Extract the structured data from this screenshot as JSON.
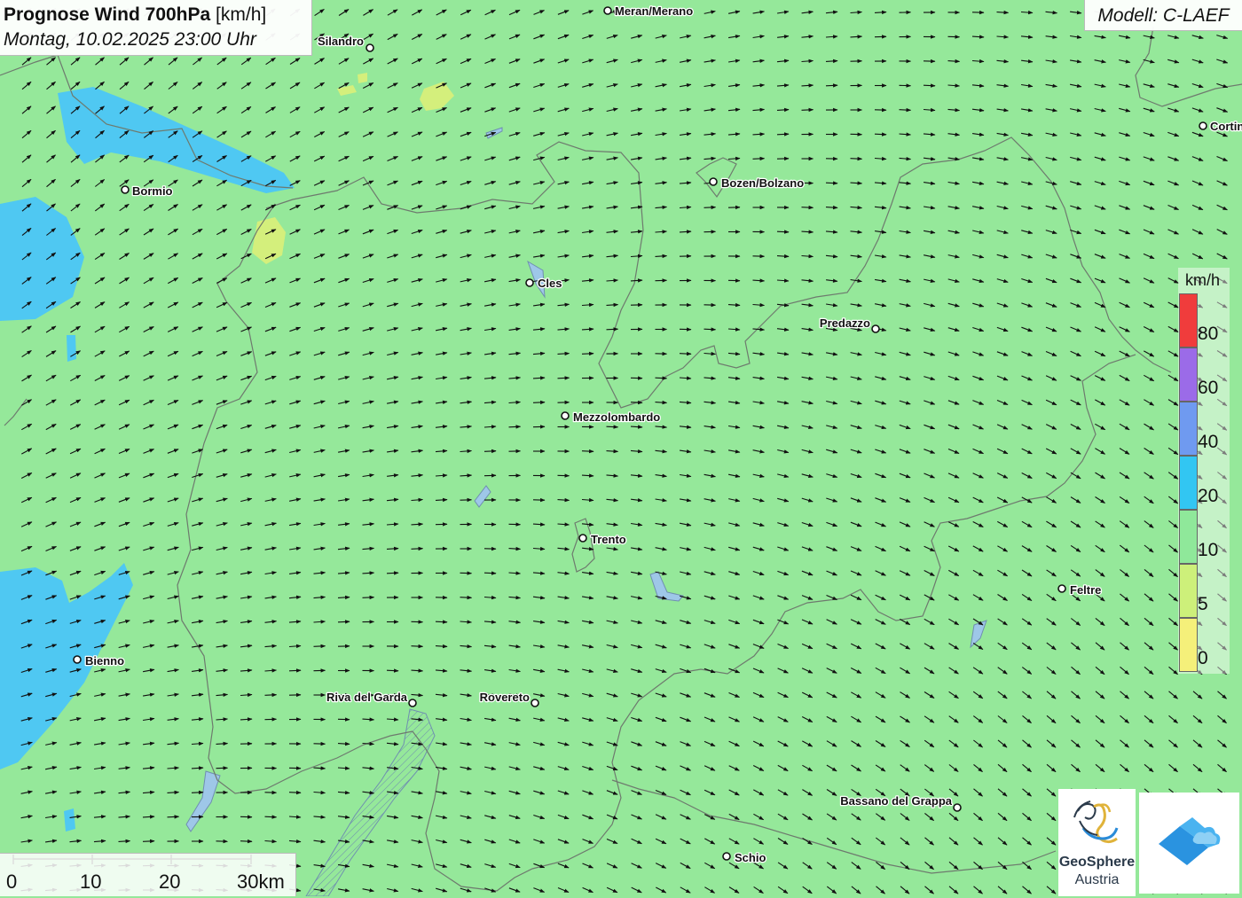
{
  "header": {
    "title_bold": "Prognose Wind 700hPa",
    "title_unit": "[km/h]",
    "subtitle": "Montag, 10.02.2025 23:00 Uhr"
  },
  "model": {
    "label": "Modell: C-LAEF"
  },
  "legend": {
    "unit": "km/h",
    "classes": [
      {
        "label": "80",
        "color": "#f03c3c"
      },
      {
        "label": "60",
        "color": "#9b6be8"
      },
      {
        "label": "40",
        "color": "#6f9af0"
      },
      {
        "label": "20",
        "color": "#32c6f2"
      },
      {
        "label": "10",
        "color": "#8fe89a"
      },
      {
        "label": "5",
        "color": "#cdf07a"
      },
      {
        "label": "0",
        "color": "#f5f07a"
      }
    ]
  },
  "cities": [
    {
      "name": "Meran/Merano"
    },
    {
      "name": "Silandro"
    },
    {
      "name": "Cortina"
    },
    {
      "name": "Bormio"
    },
    {
      "name": "Bozen/Bolzano"
    },
    {
      "name": "Cles"
    },
    {
      "name": "Predazzo"
    },
    {
      "name": "Mezzolombardo"
    },
    {
      "name": "Trento"
    },
    {
      "name": "Feltre"
    },
    {
      "name": "Bienno"
    },
    {
      "name": "Riva del Garda"
    },
    {
      "name": "Rovereto"
    },
    {
      "name": "Bassano del Grappa"
    },
    {
      "name": "Schio"
    }
  ],
  "scale": {
    "labels": [
      "0",
      "10",
      "20",
      "30km"
    ]
  },
  "logos": {
    "geosphere_line1": "GeoSphere",
    "geosphere_line2": "Austria",
    "geosphere_icon": "geosphere-logo-icon",
    "app_icon": "wetter-app-logo-icon"
  },
  "colors": {
    "background_wind": "#95e89a",
    "wind_20_40": "#4fc8f2",
    "wind_5_10": "#d4ef7c",
    "lake": "#9ec7e8",
    "border": "#6e7a6e"
  },
  "wind_field": {
    "north_west_direction": "toward north-east",
    "south_east_direction": "toward south-east"
  }
}
